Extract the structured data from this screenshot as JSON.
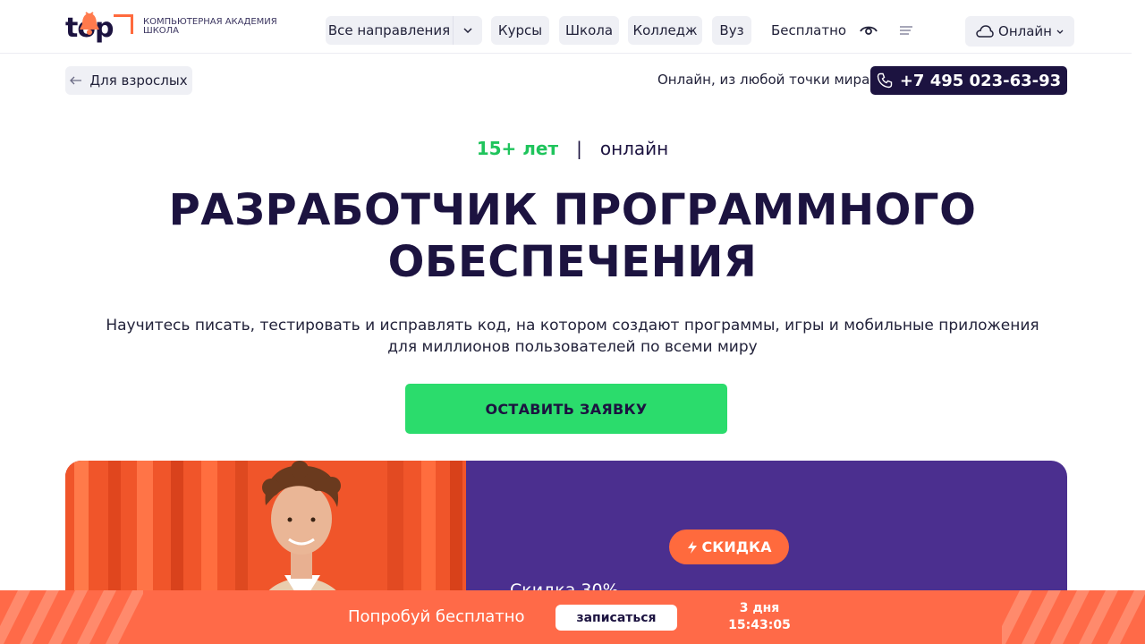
{
  "colors": {
    "brand_dark": "#1c1340",
    "accent_green": "#2bdc6c",
    "accent_orange": "#ff6a3d",
    "promo_purple": "#4b2f8f",
    "pill_bg": "#eff0f5"
  },
  "header": {
    "logo_word": "top",
    "logo_text_line1": "КОМПЬЮТЕРНАЯ АКАДЕМИЯ",
    "logo_text_line2": "ШКОЛА",
    "nav": {
      "all_directions": "Все направления",
      "courses": "Курсы",
      "school": "Школа",
      "college": "Колледж",
      "university": "Вуз",
      "free": "Бесплатно"
    },
    "icons": {
      "dropdown": "chevron-down-icon",
      "visually_impaired": "eye-icon",
      "menu": "menu-icon",
      "cloud": "cloud-icon"
    },
    "online_label": "Онлайн"
  },
  "subbar": {
    "back_label": "Для взрослых",
    "location_text": "Онлайн, из любой точки мира",
    "phone": "+7 495 023-63-93"
  },
  "hero": {
    "years": "15+ лет",
    "separator": "|",
    "format": "онлайн",
    "title_line1": "РАЗРАБОТЧИК ПРОГРАММНОГО",
    "title_line2": "ОБЕСПЕЧЕНИЯ",
    "description": "Научитесь писать, тестировать и исправлять код, на котором создают программы, игры и мобильные приложения для миллионов пользователей по всеми миру",
    "cta_label": "ОСТАВИТЬ ЗАЯВКУ"
  },
  "promo": {
    "badge_label": "СКИДКА",
    "discount_text": "Скидка 30%"
  },
  "bottom_bar": {
    "try_text": "Попробуй бесплатно",
    "signup_label": "записаться",
    "timer_days": "3 дня",
    "timer_time": "15:43:05"
  }
}
